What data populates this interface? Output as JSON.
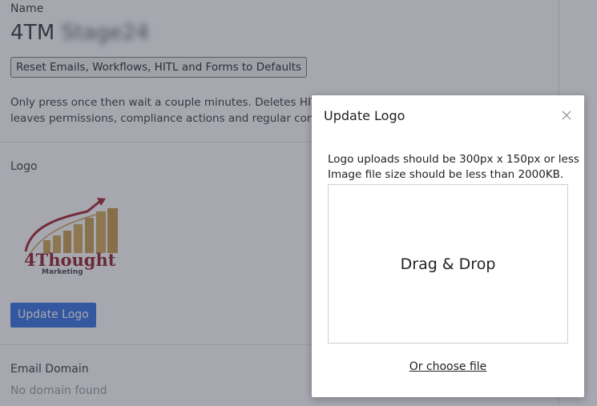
{
  "settings": {
    "name_label": "Name",
    "name_value": "4TM",
    "name_value_blurred": "Stage24",
    "reset_button": "Reset Emails, Workflows, HITL and Forms to Defaults",
    "description_line1": "Only press once then wait a couple minutes. Deletes HITL T",
    "description_line2": "leaves permissions, compliance actions and regular config",
    "logo_label": "Logo",
    "logo_brand_text": "4Thought",
    "logo_brand_sub": "Marketing",
    "update_logo_button": "Update Logo",
    "email_domain_label": "Email Domain",
    "email_domain_value": "No domain found"
  },
  "modal": {
    "title": "Update Logo",
    "close_icon": "close-icon",
    "info_line1": "Logo uploads should be 300px x 150px or less",
    "info_line2": "Image file size should be less than 2000KB.",
    "dropzone_text": "Drag & Drop",
    "choose_file_link": "Or choose file"
  },
  "colors": {
    "primary_button": "#2f6fe0",
    "overlay": "rgba(60,60,80,0.45)",
    "logo_red": "#8a1c22",
    "logo_gold": "#c9a24a"
  }
}
